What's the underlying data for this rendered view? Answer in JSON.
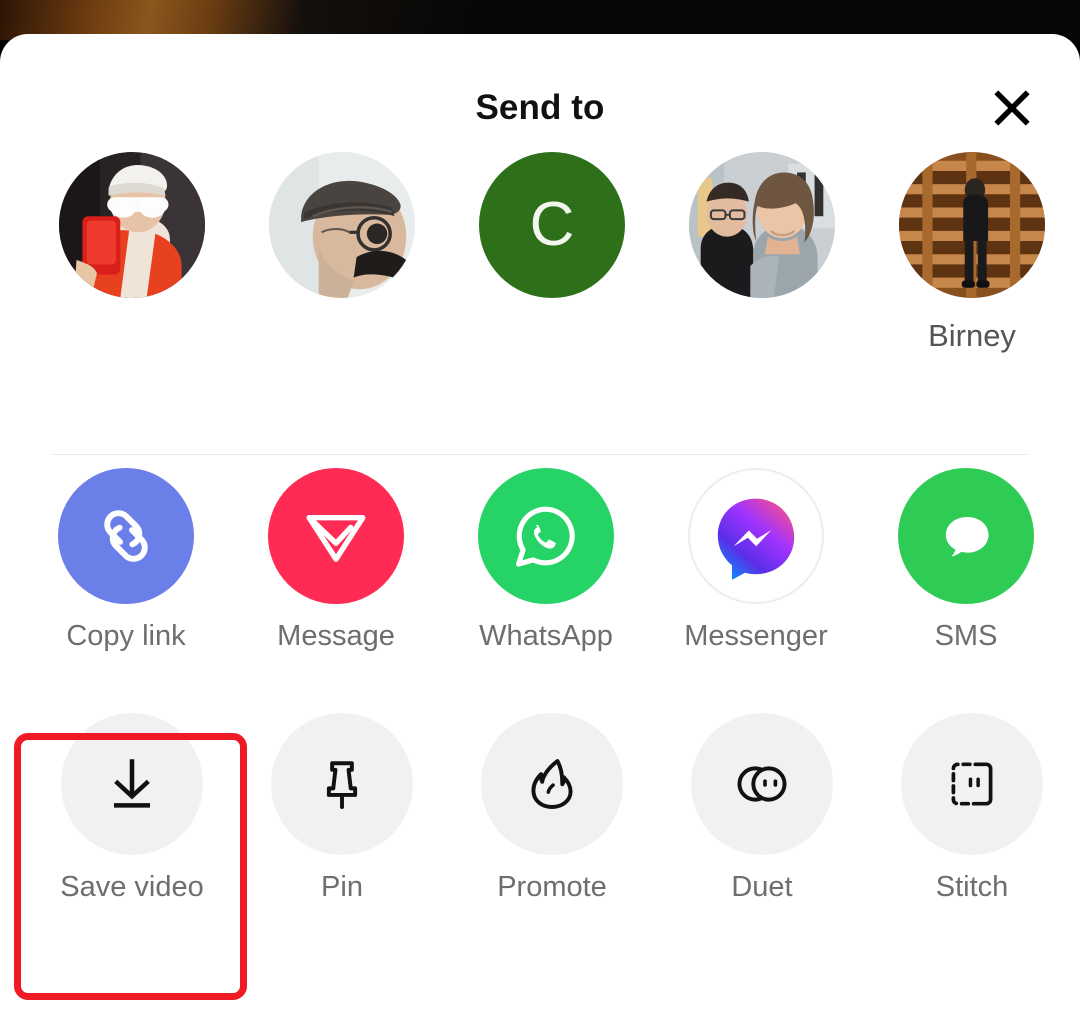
{
  "app": {
    "name": "TikTok share sheet"
  },
  "background": {
    "color": "#070505",
    "accent": "#8a561c"
  },
  "header": {
    "title": "Send to",
    "close_icon": "close-x-icon"
  },
  "divider": {
    "color": "#ececec"
  },
  "recipients": {
    "items": [
      {
        "id": "recipient-1",
        "label": "",
        "icon": "avatar-photo-person-bandana-sunglasses",
        "type": "photo"
      },
      {
        "id": "recipient-2",
        "label": "",
        "icon": "avatar-photo-person-flat-cap",
        "type": "photo"
      },
      {
        "id": "recipient-3",
        "label": "",
        "icon": "avatar-initial",
        "type": "initial",
        "initial": "C",
        "color": "#2E7019",
        "text_color": "#ffffff"
      },
      {
        "id": "recipient-4",
        "label": "",
        "icon": "avatar-photo-two-people",
        "type": "photo"
      },
      {
        "id": "recipient-5",
        "label": "Birney",
        "icon": "avatar-photo-person-wooden-pallets",
        "type": "photo"
      }
    ]
  },
  "share_targets": {
    "items": [
      {
        "id": "copy-link",
        "label": "Copy link",
        "icon": "chain-link-icon",
        "color": "#6B7FE8"
      },
      {
        "id": "message",
        "label": "Message",
        "icon": "paper-plane-icon",
        "color": "#FE2C55"
      },
      {
        "id": "whatsapp",
        "label": "WhatsApp",
        "icon": "whatsapp-icon",
        "color": "#25D366"
      },
      {
        "id": "messenger",
        "label": "Messenger",
        "icon": "messenger-icon",
        "color": "#ffffff"
      },
      {
        "id": "sms",
        "label": "SMS",
        "icon": "sms-bubble-icon",
        "color": "#2ECC55"
      }
    ]
  },
  "actions": {
    "items": [
      {
        "id": "save-video",
        "label": "Save video",
        "icon": "download-arrow-icon",
        "circle_color": "#F1F1F1",
        "highlighted": true
      },
      {
        "id": "pin",
        "label": "Pin",
        "icon": "push-pin-icon",
        "circle_color": "#F1F1F1",
        "highlighted": false
      },
      {
        "id": "promote",
        "label": "Promote",
        "icon": "flame-icon",
        "circle_color": "#F1F1F1",
        "highlighted": false
      },
      {
        "id": "duet",
        "label": "Duet",
        "icon": "duet-circles-icon",
        "circle_color": "#F1F1F1",
        "highlighted": false
      },
      {
        "id": "stitch",
        "label": "Stitch",
        "icon": "stitch-frame-icon",
        "circle_color": "#F1F1F1",
        "highlighted": false
      }
    ]
  },
  "annotation": {
    "highlight_target": "Save video",
    "color": "#EE1B24"
  }
}
